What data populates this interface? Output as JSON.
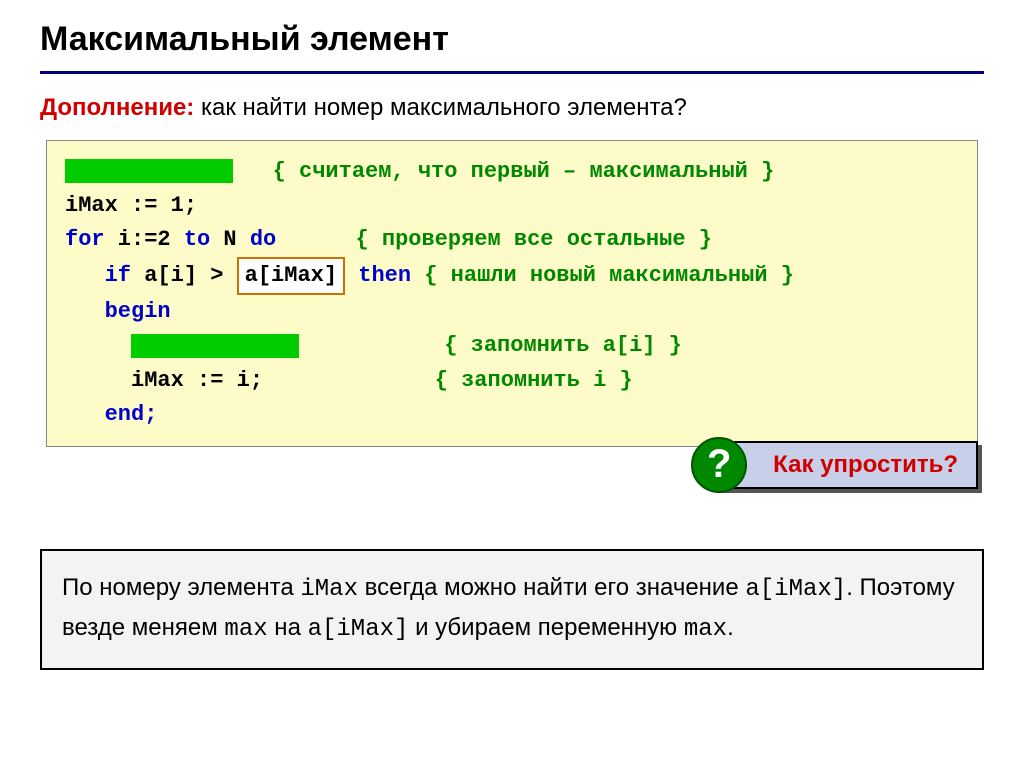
{
  "title": "Максимальный элемент",
  "subtitle": {
    "label": "Дополнение:",
    "rest": " как найти номер максимального элемента?"
  },
  "code": {
    "c1_comment": "{ считаем, что первый – максимальный }",
    "c2": "iMax := 1;",
    "c3_for": "for",
    "c3_mid": " i:=2 ",
    "c3_to": "to",
    "c3_n": " N ",
    "c3_do": "do",
    "c3_comment": "{ проверяем все остальные }",
    "c4_if": "if",
    "c4_cond": " a[i] > ",
    "c4_boxed": "a[iMax]",
    "c4_then": " then",
    "c4_comment": " { нашли новый максимальный }",
    "c5": "begin",
    "c6_comment": "{ запомнить a[i] }",
    "c7": "iMax := i;",
    "c7_comment": "{ запомнить i }",
    "c8": "end;"
  },
  "callout": "Как упростить?",
  "note": {
    "p1a": "По номеру элемента ",
    "p1b": "iMax",
    "p1c": " всегда можно найти его значение ",
    "p1d": "a[iMax]",
    "p1e": ". Поэтому везде меняем ",
    "p1f": "max",
    "p1g": " на ",
    "p1h": "a[iMax]",
    "p1i": " и убираем переменную ",
    "p1j": "max",
    "p1k": "."
  }
}
